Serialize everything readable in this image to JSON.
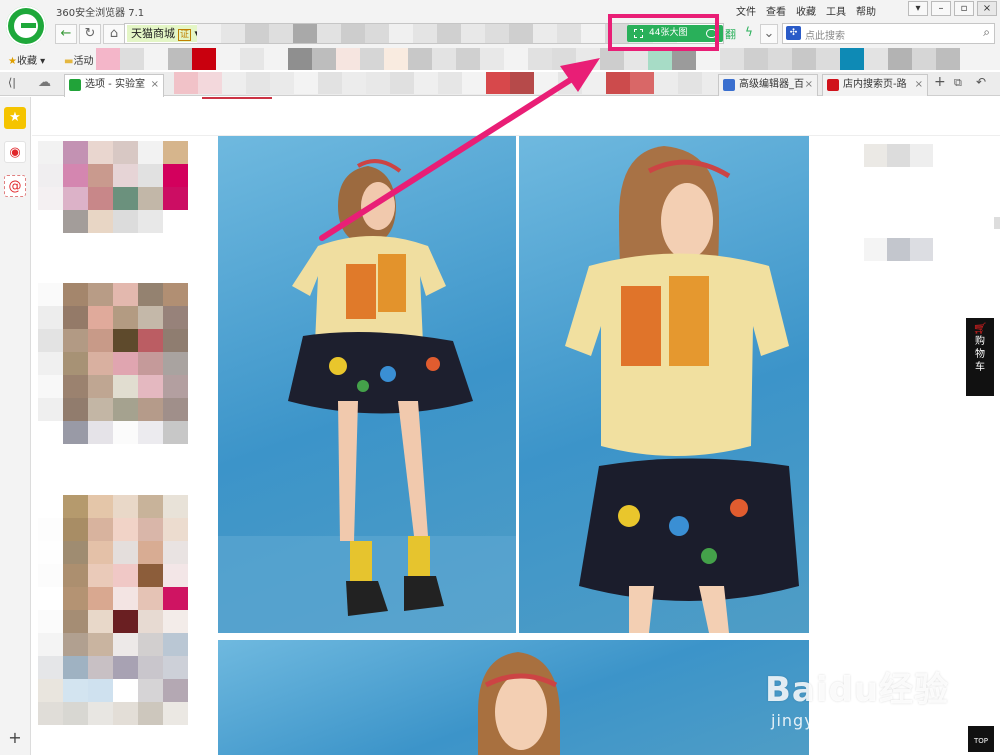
{
  "app": {
    "title": "360安全浏览器 7.1"
  },
  "menu": [
    "文件",
    "查看",
    "收藏",
    "工具",
    "帮助"
  ],
  "window_controls": [
    "shirt-icon",
    "minimize-icon",
    "restore-icon",
    "close-icon"
  ],
  "address": {
    "site_label": "天猫商城",
    "site_badge": "证",
    "bigpic_button": "44张大图"
  },
  "search": {
    "placeholder": "点此搜索"
  },
  "favorites": {
    "collect_label": "收藏",
    "folder_label": "活动"
  },
  "tabs": [
    {
      "label": "选项 - 实验室",
      "active": true,
      "icon_color": "#21a339"
    },
    {
      "label": "高级编辑器_百",
      "active": false,
      "icon_color": "#3a6fcf"
    },
    {
      "label": "店内搜索页-路",
      "active": false,
      "icon_color": "#d0121b"
    }
  ],
  "cart": {
    "label_lines": [
      "购",
      "物",
      "车"
    ]
  },
  "top_button": {
    "label": "TOP"
  },
  "watermark": {
    "brand": "Baidu经验",
    "url": "jingyan.baidu.com"
  },
  "colors": {
    "accent_green": "#29b05a",
    "highlight_pink": "#e91e76",
    "logo_green": "#1ea83a"
  }
}
